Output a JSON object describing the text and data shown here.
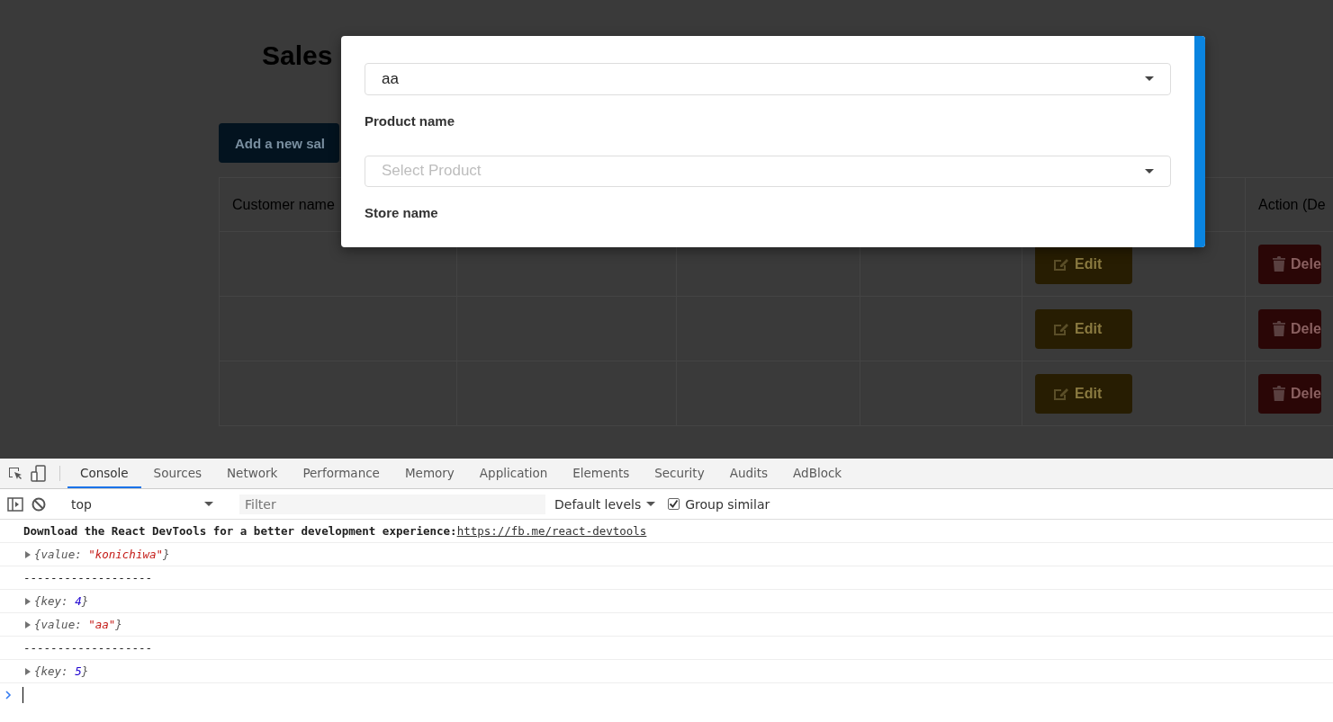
{
  "page": {
    "title": "Sales",
    "add_button": "Add a new sal",
    "table": {
      "first_column": "Customer name",
      "last_column": "Action (De",
      "rows": [
        {
          "edit": "Edit",
          "delete": "Dele"
        },
        {
          "edit": "Edit",
          "delete": "Dele"
        },
        {
          "edit": "Edit",
          "delete": "Dele"
        }
      ]
    }
  },
  "modal": {
    "fields": [
      {
        "kind": "select",
        "value": "aa"
      },
      {
        "kind": "label",
        "text": "Product name"
      },
      {
        "kind": "select",
        "placeholder": "Select Product"
      },
      {
        "kind": "label",
        "text": "Store name"
      }
    ]
  },
  "devtools": {
    "tabs": [
      {
        "label": "Console",
        "selected": true
      },
      {
        "label": "Sources",
        "selected": false
      },
      {
        "label": "Network",
        "selected": false
      },
      {
        "label": "Performance",
        "selected": false
      },
      {
        "label": "Memory",
        "selected": false
      },
      {
        "label": "Application",
        "selected": false
      },
      {
        "label": "Elements",
        "selected": false
      },
      {
        "label": "Security",
        "selected": false
      },
      {
        "label": "Audits",
        "selected": false
      },
      {
        "label": "AdBlock",
        "selected": false
      }
    ],
    "context": "top",
    "filter": {
      "placeholder": "Filter"
    },
    "levels": "Default levels",
    "group_similar": {
      "label": "Group similar",
      "checked": true
    },
    "console": [
      {
        "kind": "info",
        "text": "Download the React DevTools for a better development experience: ",
        "link": "https://fb.me/react-devtools"
      },
      {
        "kind": "object",
        "parts": [
          {
            "text": "{value: "
          },
          {
            "text": "\"konichiwa\"",
            "color": "#c41a16"
          },
          {
            "text": "}"
          }
        ]
      },
      {
        "kind": "text",
        "text": "-------------------"
      },
      {
        "kind": "object",
        "parts": [
          {
            "text": "{key: "
          },
          {
            "text": "4",
            "color": "#1c00cf"
          },
          {
            "text": "}"
          }
        ]
      },
      {
        "kind": "object",
        "parts": [
          {
            "text": "{value: "
          },
          {
            "text": "\"aa\"",
            "color": "#c41a16"
          },
          {
            "text": "}"
          }
        ]
      },
      {
        "kind": "text",
        "text": "-------------------"
      },
      {
        "kind": "object",
        "parts": [
          {
            "text": "{key: "
          },
          {
            "text": "5",
            "color": "#1c00cf"
          },
          {
            "text": "}"
          }
        ]
      }
    ]
  }
}
